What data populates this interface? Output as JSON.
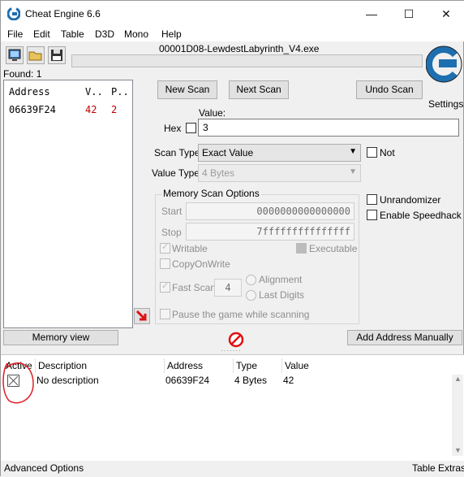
{
  "window": {
    "title": "Cheat Engine 6.6",
    "minimize": "—",
    "maximize": "☐",
    "close": "✕"
  },
  "menu": [
    "File",
    "Edit",
    "Table",
    "D3D",
    "Mono",
    "Help"
  ],
  "process_name": "00001D08-LewdestLabyrinth_V4.exe",
  "settings_label": "Settings",
  "found_label": "Found: 1",
  "results": {
    "headers": [
      "Address",
      "V..",
      "P.."
    ],
    "rows": [
      {
        "address": "06639F24",
        "value": "42",
        "previous": "2"
      }
    ]
  },
  "scan_buttons": {
    "new_scan": "New Scan",
    "next_scan": "Next Scan",
    "undo_scan": "Undo Scan"
  },
  "value_section": {
    "value_label": "Value:",
    "hex_label": "Hex",
    "value": "3"
  },
  "scan_type": {
    "label": "Scan Type",
    "selected": "Exact Value",
    "not_label": "Not"
  },
  "value_type": {
    "label": "Value Type",
    "selected": "4 Bytes"
  },
  "memory_options": {
    "title": "Memory Scan Options",
    "start_label": "Start",
    "start_value": "0000000000000000",
    "stop_label": "Stop",
    "stop_value": "7fffffffffffffff",
    "writable": "Writable",
    "executable": "Executable",
    "copy_on_write": "CopyOnWrite",
    "fast_scan": "Fast Scan",
    "fast_scan_value": "4",
    "alignment": "Alignment",
    "last_digits": "Last Digits",
    "pause": "Pause the game while scanning"
  },
  "extra_options": {
    "unrandomizer": "Unrandomizer",
    "speedhack": "Enable Speedhack"
  },
  "bottom_buttons": {
    "memory_view": "Memory view",
    "add_address": "Add Address Manually"
  },
  "address_list": {
    "headers": [
      "Active",
      "Description",
      "Address",
      "Type",
      "Value"
    ],
    "rows": [
      {
        "description": "No description",
        "address": "06639F24",
        "type": "4 Bytes",
        "value": "42"
      }
    ]
  },
  "status": {
    "left": "Advanced Options",
    "right": "Table Extras"
  },
  "colors": {
    "accent": "#1e6fb0",
    "red_value": "#c00000",
    "annotation": "#e31b23"
  }
}
